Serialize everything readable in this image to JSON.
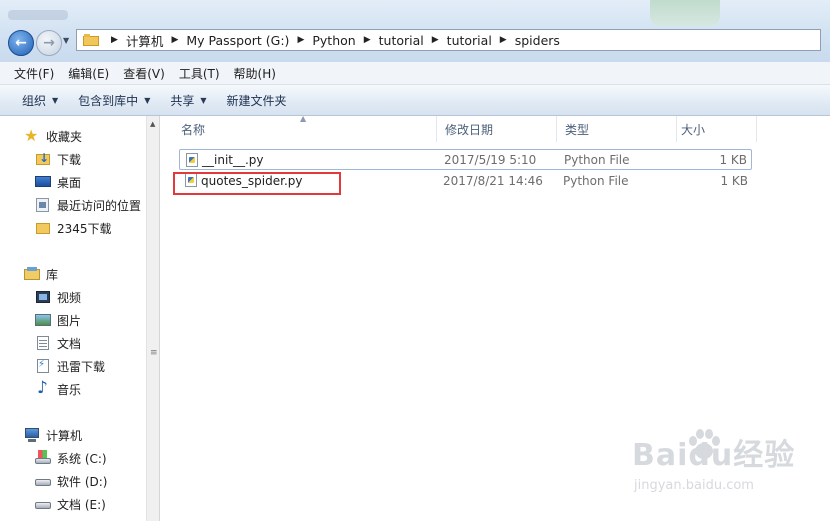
{
  "address": {
    "crumbs": [
      "计算机",
      "My Passport (G:)",
      "Python",
      "tutorial",
      "tutorial",
      "spiders"
    ]
  },
  "menu": [
    "文件(F)",
    "编辑(E)",
    "查看(V)",
    "工具(T)",
    "帮助(H)"
  ],
  "commands": {
    "organize": "组织",
    "include_library": "包含到库中",
    "share": "共享",
    "new_folder": "新建文件夹"
  },
  "nav": {
    "favorites": "收藏夹",
    "downloads": "下载",
    "desktop": "桌面",
    "recent": "最近访问的位置",
    "dl2345": "2345下载",
    "libraries": "库",
    "videos": "视频",
    "pictures": "图片",
    "documents": "文档",
    "xunlei": "迅雷下载",
    "music": "音乐",
    "computer": "计算机",
    "drive_c": "系统 (C:)",
    "drive_d": "软件 (D:)",
    "drive_e": "文档 (E:)"
  },
  "columns": {
    "name": "名称",
    "modified": "修改日期",
    "type": "类型",
    "size": "大小"
  },
  "files": [
    {
      "name": "__init__.py",
      "modified": "2017/5/19 5:10",
      "type": "Python File",
      "size": "1 KB"
    },
    {
      "name": "quotes_spider.py",
      "modified": "2017/8/21 14:46",
      "type": "Python File",
      "size": "1 KB"
    }
  ],
  "watermark": {
    "brand": "Baidu经验",
    "url": "jingyan.baidu.com"
  },
  "colors": {
    "highlight": "#e23a3a",
    "selection": "#9fb8d8"
  }
}
